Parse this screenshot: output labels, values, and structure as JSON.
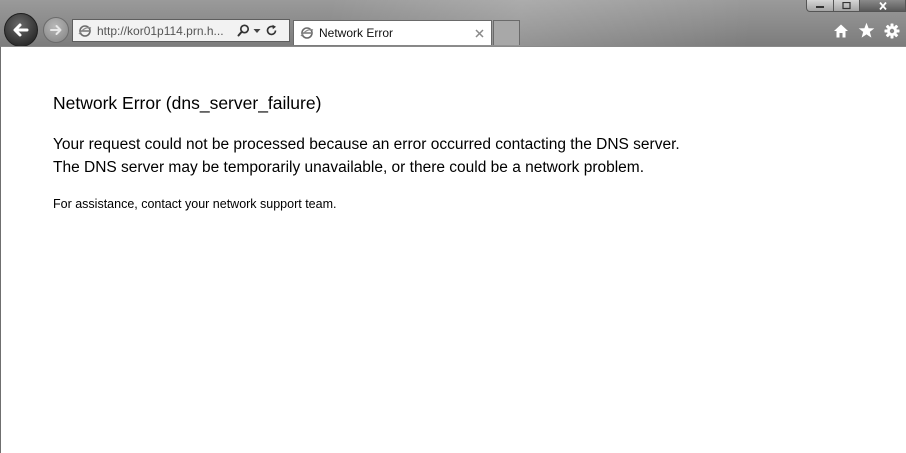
{
  "browser": {
    "address_url": "http://kor01p114.prn.h...",
    "tab_title": "Network Error",
    "icons": {
      "back": "back-arrow-icon",
      "forward": "forward-arrow-icon",
      "page": "ie-page-icon",
      "search": "search-icon",
      "dropdown": "chevron-down-icon",
      "refresh": "refresh-icon",
      "close_tab": "close-icon",
      "home": "home-icon",
      "favorites": "star-icon",
      "tools": "gear-icon",
      "minimize": "minimize-icon",
      "maximize": "maximize-icon",
      "close_window": "close-window-icon"
    }
  },
  "page": {
    "title": "Network Error (dns_server_failure)",
    "message_line1": "Your request could not be processed because an error occurred contacting the DNS server.",
    "message_line2": "The DNS server may be temporarily unavailable, or there could be a network problem.",
    "assistance": "For assistance, contact your network support team."
  }
}
